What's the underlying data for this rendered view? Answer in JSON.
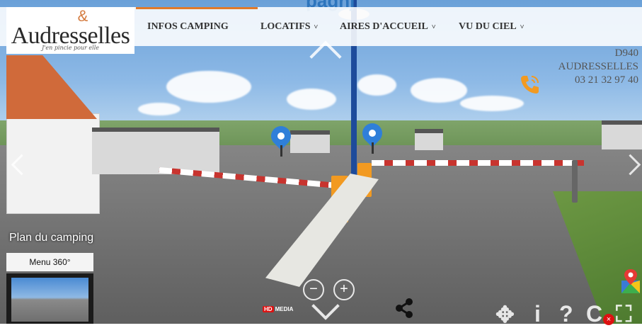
{
  "page": {
    "partial_title": "pagnj"
  },
  "logo": {
    "name": "Audresselles",
    "tagline": "J'en pincie pour elle",
    "emblem": "&"
  },
  "nav": {
    "items": [
      {
        "label": "INFOS CAMPING",
        "dropdown": false
      },
      {
        "label": "LOCATIFS",
        "dropdown": true
      },
      {
        "label": "AIRES D'ACCUEIL",
        "dropdown": true
      },
      {
        "label": "VU DU CIEL",
        "dropdown": true
      }
    ],
    "chevron": "˅"
  },
  "address": {
    "road": "D940",
    "town": "AUDRESSELLES",
    "phone": "03 21 32 97 40"
  },
  "viewer": {
    "plan_label": "Plan du camping",
    "menu_label": "Menu 360°",
    "brand_tag": "HD",
    "brand_name": "MEDIA",
    "zoom_out": "−",
    "zoom_in": "+",
    "controls": {
      "move": "✥",
      "info": "i",
      "help": "?",
      "rotate": "C",
      "fullscreen": "⛶",
      "close": "×"
    }
  },
  "colors": {
    "accent": "#e07a2a",
    "brand_blue": "#2d75bd",
    "pin": "#2f7fd9",
    "phone": "#f29a21"
  },
  "icons": [
    "phone-icon",
    "share-icon",
    "map-pin-icon",
    "chevron-down-icon"
  ]
}
